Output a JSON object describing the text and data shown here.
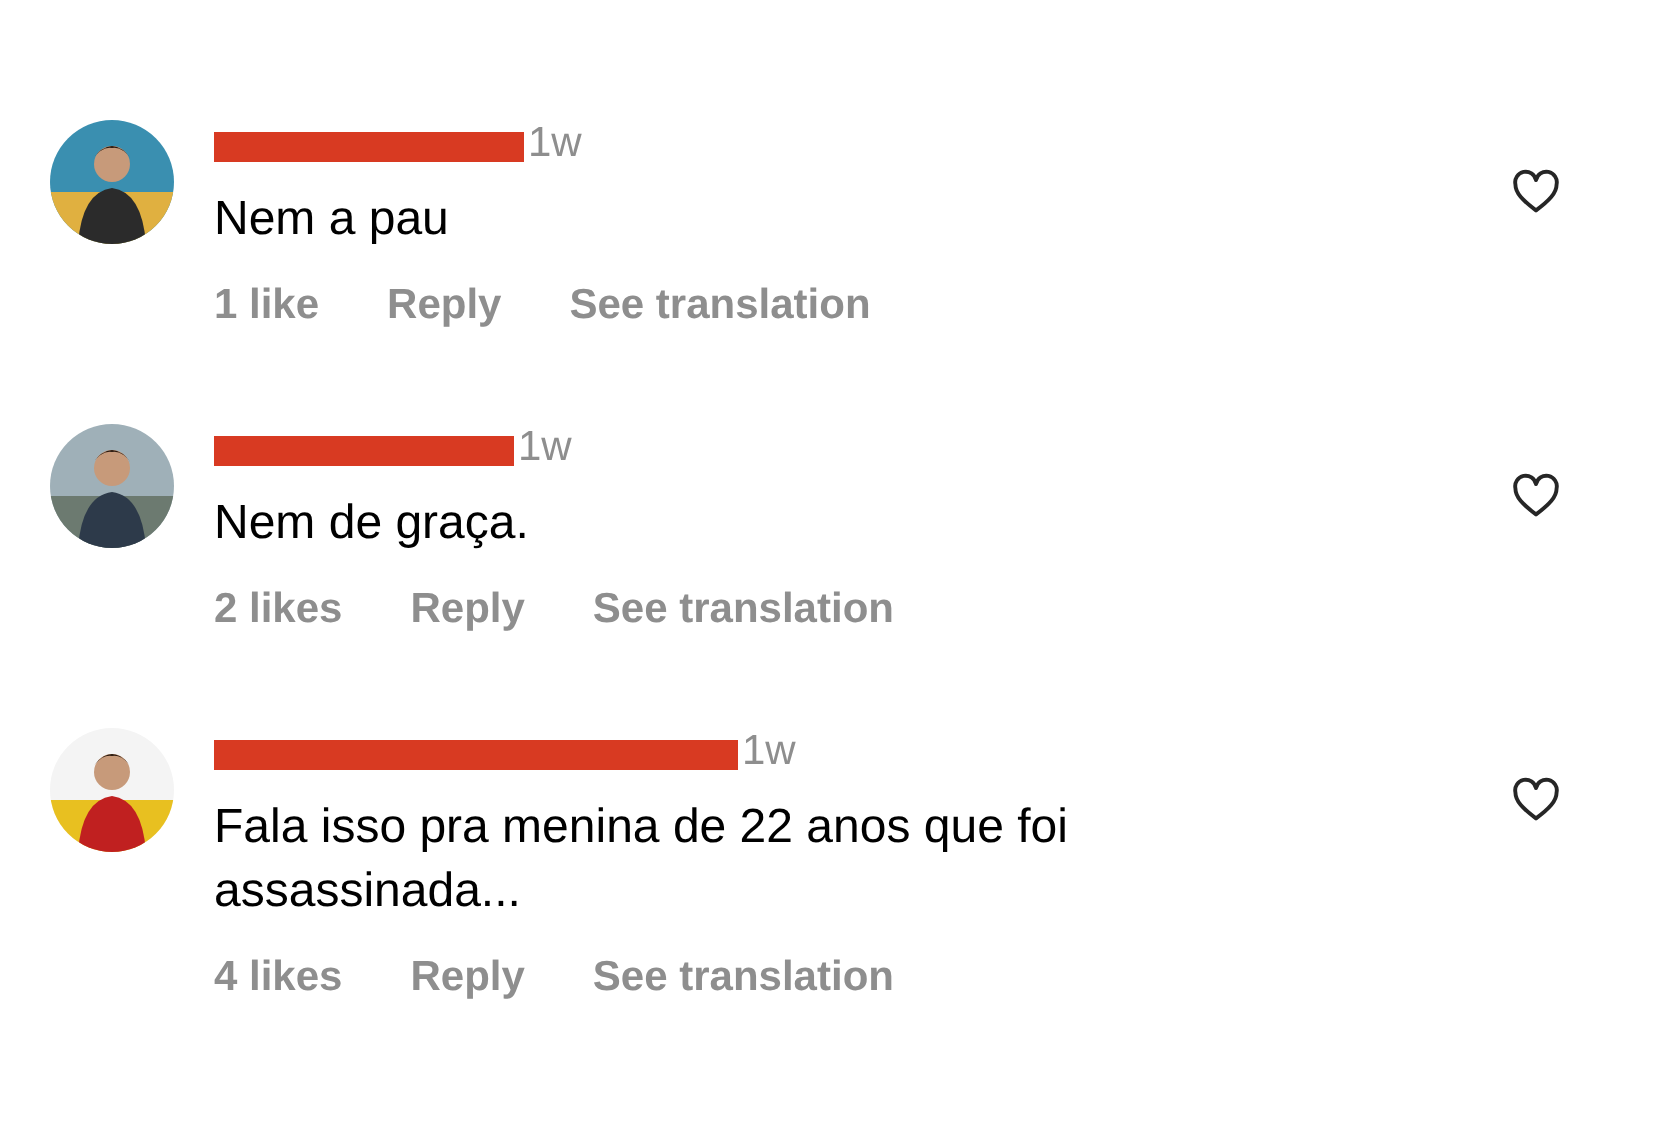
{
  "comments": [
    {
      "username_redacted": true,
      "time": "1w",
      "text": "Nem a pau",
      "likes": "1 like",
      "reply": "Reply",
      "translate": "See translation",
      "liked": false
    },
    {
      "username_redacted": true,
      "time": "1w",
      "text": "Nem de graça.",
      "likes": "2 likes",
      "reply": "Reply",
      "translate": "See translation",
      "liked": false
    },
    {
      "username_redacted": true,
      "time": "1w",
      "text": "Fala isso pra menina de 22 anos que foi assassinada...",
      "likes": "4 likes",
      "reply": "Reply",
      "translate": "See translation",
      "liked": false
    }
  ]
}
